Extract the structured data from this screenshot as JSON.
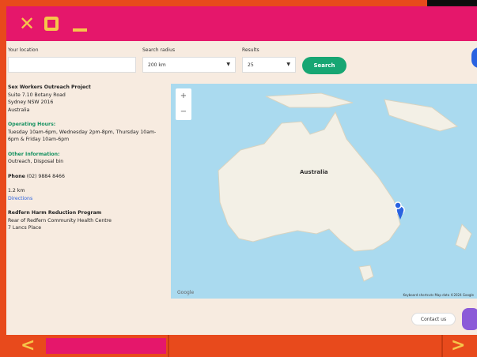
{
  "window": {
    "close_glyph": "✕",
    "restore_icon": "square-icon",
    "minimize_icon": "minus-icon"
  },
  "search": {
    "location_label": "Your location",
    "location_value": "",
    "radius_label": "Search radius",
    "radius_value": "200 km",
    "results_label": "Results",
    "results_value": "25",
    "search_button": "Search"
  },
  "listing": {
    "first": {
      "name": "Sex Workers Outreach Project",
      "address1": "Suite 7.10 Botany Road",
      "address2": "Sydney NSW 2016",
      "country": "Australia",
      "hours_label": "Operating Hours:",
      "hours_text": "Tuesday 10am-6pm, Wednesday 2pm-8pm, Thursday 10am-6pm & Friday 10am-6pm",
      "other_label": "Other Information:",
      "other_text": "Outreach, Disposal bin",
      "phone_label": "Phone",
      "phone_value": "(02) 9884 8466",
      "distance": "1.2 km",
      "directions": "Directions"
    },
    "second": {
      "name": "Redfern Harm Reduction Program",
      "address1": "Rear of Redfern Community Health Centre",
      "address2": "7 Lancs Place"
    }
  },
  "map": {
    "country_label": "Australia",
    "zoom_in": "+",
    "zoom_out": "−",
    "logo": "Google",
    "attribution": "Keyboard shortcuts   Map data ©2024 Google"
  },
  "footer": {
    "contact_button": "Contact us"
  },
  "nav": {
    "prev": "<",
    "next": ">"
  },
  "colors": {
    "accent": "#e5176b",
    "frame": "#e84a1c",
    "icon": "#f6c64a",
    "green": "#17a673"
  }
}
